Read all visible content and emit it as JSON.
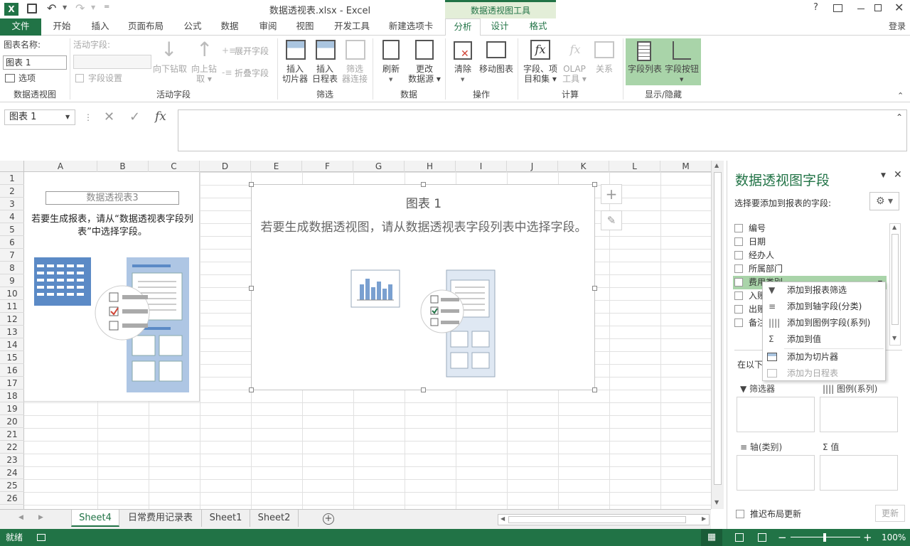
{
  "window": {
    "title": "数据透视表.xlsx - Excel",
    "context_tool": "数据透视图工具",
    "signin": "登录"
  },
  "tabs": [
    "文件",
    "开始",
    "插入",
    "页面布局",
    "公式",
    "数据",
    "审阅",
    "视图",
    "开发工具",
    "新建选项卡",
    "分析",
    "设计",
    "格式"
  ],
  "ribbon": {
    "chart_name_label": "图表名称:",
    "chart_name_value": "图表 1",
    "options": "选项",
    "group_pivotchart": "数据透视图",
    "active_field_label": "活动字段:",
    "field_settings": "字段设置",
    "drill_down": "向下钻取",
    "drill_up_1": "向上钻",
    "drill_up_2": "取 ▾",
    "expand_field": "展开字段",
    "collapse_field": "折叠字段",
    "group_active_field": "活动字段",
    "insert_slicer_1": "插入",
    "insert_slicer_2": "切片器",
    "insert_timeline_1": "插入",
    "insert_timeline_2": "日程表",
    "filter_conn_1": "筛选",
    "filter_conn_2": "器连接",
    "group_filter": "筛选",
    "refresh": "刷新",
    "change_source_1": "更改",
    "change_source_2": "数据源 ▾",
    "group_data": "数据",
    "clear": "清除",
    "move_chart": "移动图表",
    "group_actions": "操作",
    "fields_items_1": "字段、项",
    "fields_items_2": "目和集 ▾",
    "olap_1": "OLAP",
    "olap_2": "工具 ▾",
    "relationships": "关系",
    "group_calc": "计算",
    "field_list": "字段列表",
    "field_buttons": "字段按钮",
    "group_showhide": "显示/隐藏"
  },
  "formula": {
    "namebox": "图表 1",
    "fx": "fx"
  },
  "columns": [
    "A",
    "B",
    "C",
    "D",
    "E",
    "F",
    "G",
    "H",
    "I",
    "J",
    "K",
    "L",
    "M"
  ],
  "rows": [
    "1",
    "2",
    "3",
    "4",
    "5",
    "6",
    "7",
    "8",
    "9",
    "10",
    "11",
    "12",
    "13",
    "14",
    "15",
    "16",
    "17",
    "18",
    "19",
    "20",
    "21",
    "22",
    "23",
    "24",
    "25",
    "26"
  ],
  "pivot": {
    "title": "数据透视表3",
    "msg": "若要生成报表，请从“数据透视表字段列表”中选择字段。"
  },
  "chart": {
    "title": "图表 1",
    "msg": "若要生成数据透视图，请从数据透视表字段列表中选择字段。"
  },
  "sheets": [
    "Sheet4",
    "日常费用记录表",
    "Sheet1",
    "Sheet2"
  ],
  "status": {
    "ready": "就绪",
    "zoom": "100%"
  },
  "pane": {
    "title": "数据透视图字段",
    "subtitle": "选择要添加到报表的字段:",
    "fields": [
      "编号",
      "日期",
      "经办人",
      "所属部门",
      "费用类别",
      "入账",
      "出账",
      "备注"
    ],
    "drag_hint": "在以下",
    "zone_filter": "筛选器",
    "zone_legend": "图例(系列)",
    "zone_axis": "轴(类别)",
    "zone_values": "值",
    "defer": "推迟布局更新",
    "update": "更新"
  },
  "menu": [
    "添加到报表筛选",
    "添加到轴字段(分类)",
    "添加到图例字段(系列)",
    "添加到值",
    "添加为切片器",
    "添加为日程表"
  ],
  "colors": {
    "accent": "#217346",
    "ctx_bg": "#e3eed8",
    "highlight": "#a9d4a9"
  }
}
